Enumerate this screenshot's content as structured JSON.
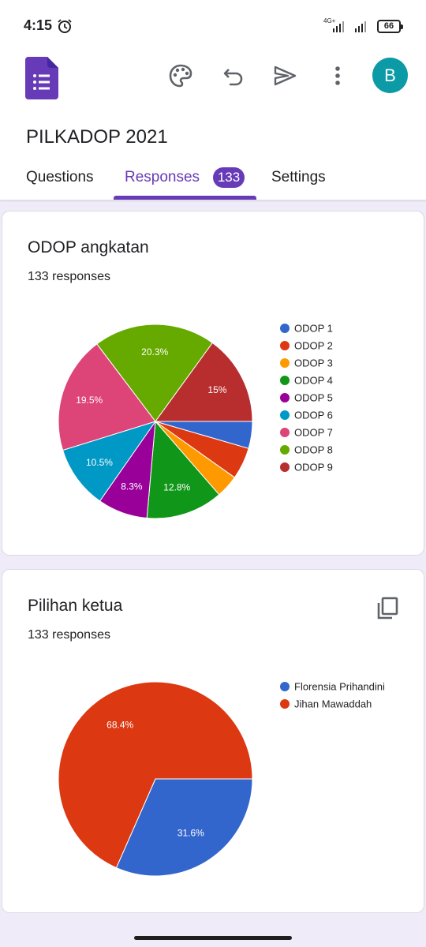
{
  "status": {
    "time": "4:15",
    "network": "4G+",
    "battery": "66"
  },
  "header": {
    "title": "PILKADOP 2021",
    "avatar_letter": "B",
    "tabs": [
      {
        "label": "Questions"
      },
      {
        "label": "Responses",
        "badge": "133"
      },
      {
        "label": "Settings"
      }
    ],
    "icons": [
      "forms-logo-icon",
      "palette-icon",
      "undo-icon",
      "send-icon",
      "more-vert-icon"
    ]
  },
  "colors": {
    "accent": "#673ab7",
    "avatar": "#0c9aa6",
    "background": "#f0ebf8"
  },
  "cards": [
    {
      "title": "ODOP angkatan",
      "responses": "133 responses",
      "chart_data": {
        "type": "pie",
        "categories": [
          "ODOP 1",
          "ODOP 2",
          "ODOP 3",
          "ODOP 4",
          "ODOP 5",
          "ODOP 6",
          "ODOP 7",
          "ODOP 8",
          "ODOP 9"
        ],
        "values": [
          4.5,
          5.3,
          3.8,
          12.8,
          8.3,
          10.5,
          19.5,
          20.3,
          15.0
        ],
        "slice_labels": [
          "",
          "",
          "",
          "12.8%",
          "8.3%",
          "10.5%",
          "19.5%",
          "20.3%",
          "15%"
        ],
        "colors": [
          "#3366cc",
          "#dc3912",
          "#ff9900",
          "#109618",
          "#990099",
          "#0099c6",
          "#dd4477",
          "#66aa00",
          "#b82e2e"
        ],
        "legend_position": "right"
      }
    },
    {
      "title": "Pilihan ketua",
      "responses": "133 responses",
      "chart_data": {
        "type": "pie",
        "categories": [
          "Florensia Prihandini",
          "Jihan Mawaddah"
        ],
        "values": [
          31.6,
          68.4
        ],
        "slice_labels": [
          "31.6%",
          "68.4%"
        ],
        "colors": [
          "#3366cc",
          "#dc3912"
        ],
        "legend_position": "right"
      }
    }
  ]
}
